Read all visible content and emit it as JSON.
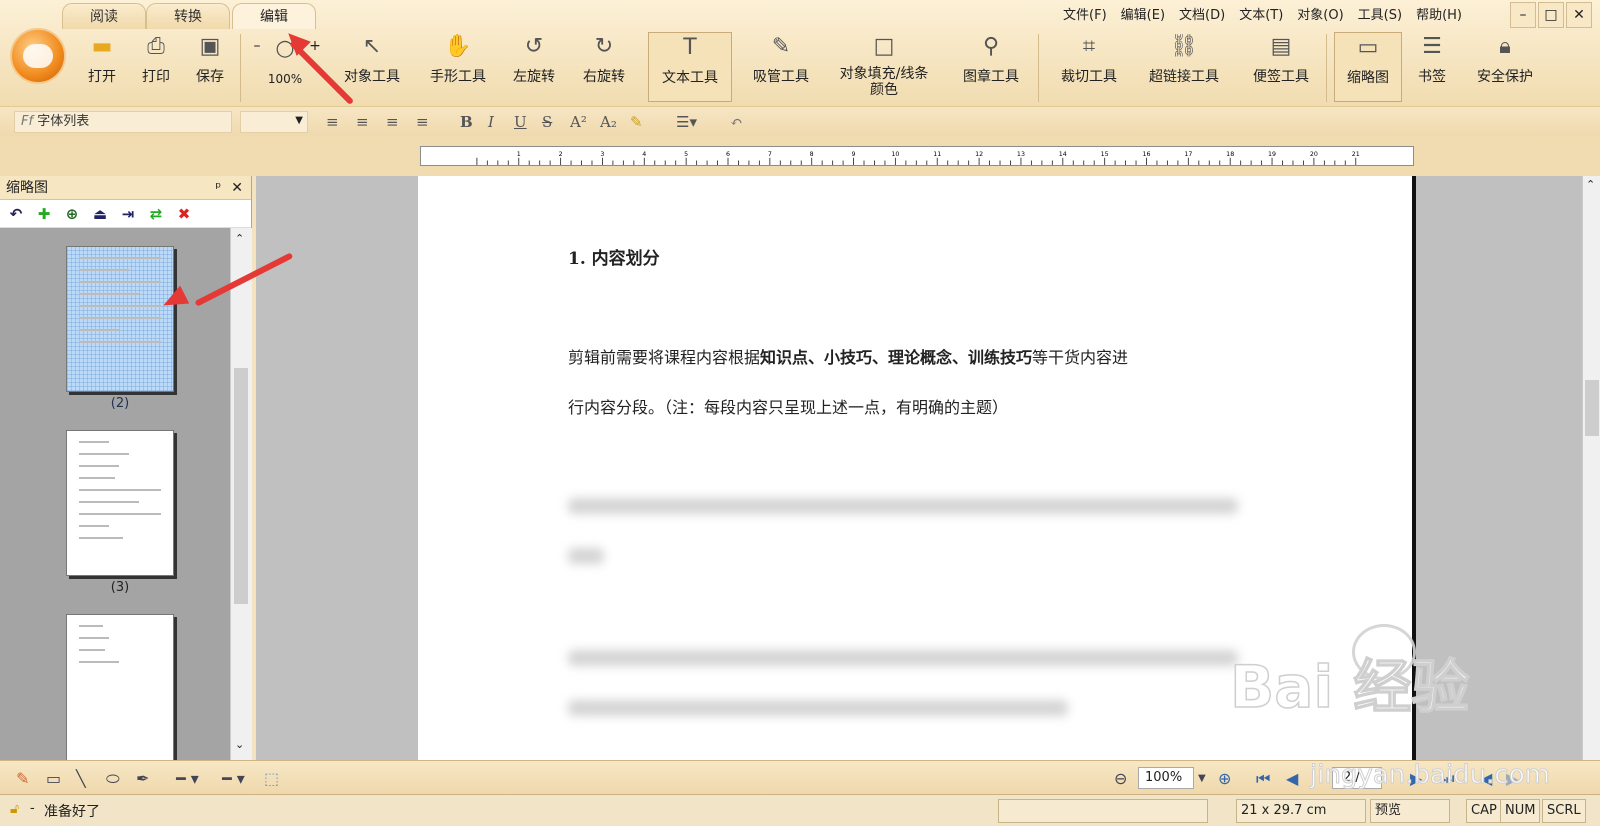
{
  "tabs": [
    {
      "label": "阅读"
    },
    {
      "label": "转换"
    },
    {
      "label": "编辑"
    }
  ],
  "menu": [
    "文件(F)",
    "编辑(E)",
    "文档(D)",
    "文本(T)",
    "对象(O)",
    "工具(S)",
    "帮助(H)"
  ],
  "window": {
    "minimize": "–",
    "maximize": "□",
    "close": "✕"
  },
  "toolbar": {
    "open": "打开",
    "print": "打印",
    "save": "保存",
    "zoom_minus": "–",
    "zoom_plus": "+",
    "zoom_level": "100%",
    "object_tool": "对象工具",
    "hand_tool": "手形工具",
    "rotate_left": "左旋转",
    "rotate_right": "右旋转",
    "text_tool": "文本工具",
    "eyedropper_tool": "吸管工具",
    "fill_line_1": "对象填充/线条",
    "fill_line_2": "颜色",
    "stamp_tool": "图章工具",
    "crop_tool": "裁切工具",
    "hyperlink_tool": "超链接工具",
    "note_tool": "便签工具",
    "thumbnail": "缩略图",
    "bookmark": "书签",
    "security": "安全保护"
  },
  "format": {
    "font_list": "字体列表",
    "bold": "B",
    "italic": "I",
    "underline": "U",
    "strike": "S",
    "superscript": "A²",
    "subscript": "A₂"
  },
  "sidebar": {
    "title": "缩略图",
    "pin": "ᵖ",
    "close": "✕",
    "thumb_labels": [
      "(2)",
      "(3)"
    ]
  },
  "document": {
    "heading": "1. 内容划分",
    "para1_a": "剪辑前需要将课程内容根据",
    "para1_b": "知识点、小技巧、理论概念、训练技巧",
    "para1_c": "等干货内容进",
    "para2": "行内容分段。（注：每段内容只呈现上述一点，有明确的主题）"
  },
  "bottombar": {
    "zoom": "100%",
    "page": "2 /"
  },
  "status": {
    "ready": "准备好了",
    "size": "21 x 29.7 cm",
    "preview": "预览",
    "cap": "CAP",
    "num": "NUM",
    "scrl": "SCRL"
  },
  "watermark": {
    "brand": "Bai   经验",
    "url": "jingyan.baidu.com"
  },
  "accent_colors": {
    "annotation_arrow": "#e53935",
    "toolbar_bg": "#f3e3c0"
  }
}
